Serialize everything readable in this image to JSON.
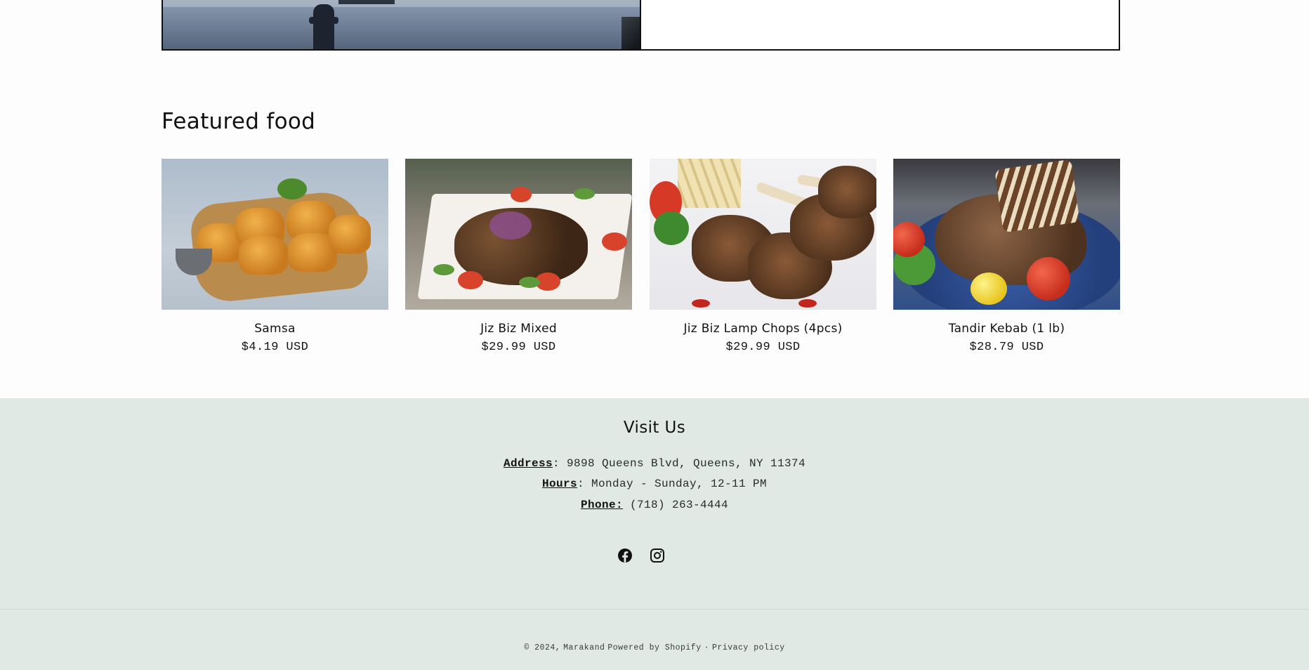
{
  "section": {
    "title": "Featured food"
  },
  "products": [
    {
      "name": "Samsa",
      "price": "$4.19 USD"
    },
    {
      "name": "Jiz Biz Mixed",
      "price": "$29.99 USD"
    },
    {
      "name": "Jiz Biz Lamp Chops (4pcs)",
      "price": "$29.99 USD"
    },
    {
      "name": "Tandir Kebab (1 lb)",
      "price": "$28.79 USD"
    }
  ],
  "visit": {
    "title": "Visit Us",
    "address_label": "Address",
    "address_value": ": 9898 Queens Blvd, Queens, NY 11374",
    "hours_label": "Hours",
    "hours_value": ": Monday - Sunday, 12-11 PM",
    "phone_label": "Phone:",
    "phone_value": " (718) 263-4444"
  },
  "social": {
    "icons": [
      "facebook-icon",
      "instagram-icon"
    ]
  },
  "footer": {
    "copyright": "© 2024,",
    "store_name": "Marakand",
    "powered_by": "Powered by Shopify",
    "separator": "·",
    "privacy": "Privacy policy"
  },
  "colors": {
    "footer_bg": "#e1e9e4",
    "page_bg": "#fdfdfd",
    "text": "#121212"
  }
}
